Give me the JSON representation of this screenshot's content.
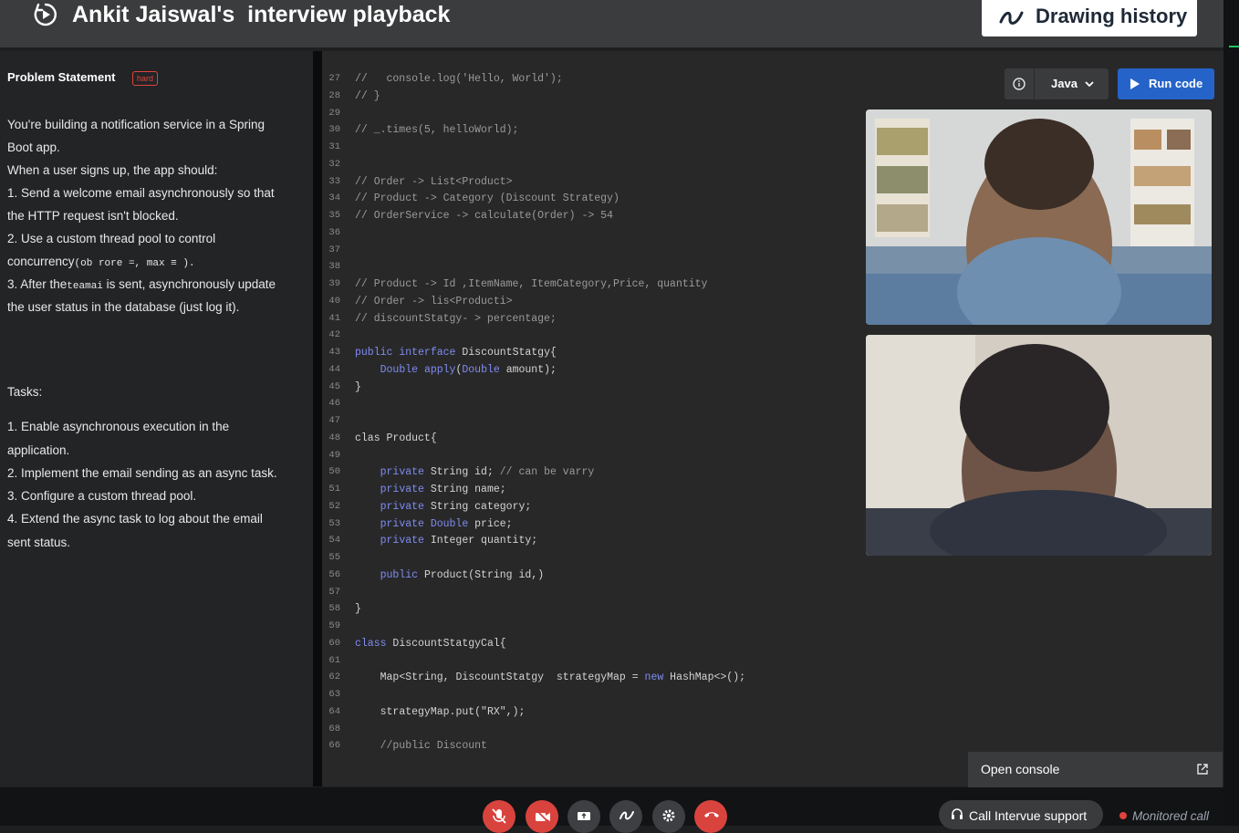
{
  "header": {
    "title": "Ankit Jaiswal's  interview playback",
    "drawing_history_label": "Drawing history"
  },
  "problem": {
    "heading": "Problem Statement",
    "difficulty": "hard",
    "paragraphs": [
      "You're building a notification service in a Spring",
      "Boot app.",
      " When a user signs up, the app should:",
      "1. Send a welcome email asynchronously so that",
      "the HTTP request isn't blocked.",
      "2. Use a custom thread pool to control",
      "3. After the",
      " is sent, asynchronously update",
      "the user status in the database (just log it)."
    ],
    "concurrency_prefix": "concurrency",
    "concurrency_smudge": "(ob rore =, max ≡ ).",
    "after_smudge": "teamai",
    "tasks_heading": "Tasks:",
    "tasks": [
      "1. Enable asynchronous execution in the",
      "application.",
      "2. Implement the email sending as an async task.",
      "3. Configure a custom thread pool.",
      "4. Extend the async task to log about the email",
      "sent status."
    ]
  },
  "toolbar": {
    "language": "Java",
    "run_label": "Run code"
  },
  "code": [
    {
      "n": "27",
      "t": "//   console.log('Hello, World');",
      "k": "com"
    },
    {
      "n": "28",
      "t": "// }",
      "k": "com"
    },
    {
      "n": "29",
      "t": "",
      "k": ""
    },
    {
      "n": "30",
      "t": "// _.times(5, helloWorld);",
      "k": "com"
    },
    {
      "n": "31",
      "t": "",
      "k": ""
    },
    {
      "n": "32",
      "t": "",
      "k": ""
    },
    {
      "n": "33",
      "t": "// Order -> List<Product>",
      "k": "com"
    },
    {
      "n": "34",
      "t": "// Product -> Category (Discount Strategy)",
      "k": "com"
    },
    {
      "n": "35",
      "t": "// OrderService -> calculate(Order) -> 54",
      "k": "com"
    },
    {
      "n": "36",
      "t": "",
      "k": ""
    },
    {
      "n": "37",
      "t": "",
      "k": ""
    },
    {
      "n": "38",
      "t": "",
      "k": ""
    },
    {
      "n": "39",
      "t": "// Product -> Id ,ItemName, ItemCategory,Price, quantity",
      "k": "com"
    },
    {
      "n": "40",
      "t": "// Order -> lis<Producti>",
      "k": "com"
    },
    {
      "n": "41",
      "t": "// discountStatgy- > percentage;",
      "k": "com"
    },
    {
      "n": "42",
      "t": "",
      "k": ""
    },
    {
      "n": "43",
      "t": "public interface DiscountStatgy{",
      "k": "code"
    },
    {
      "n": "44",
      "t": "    Double apply(Double amount);",
      "k": "code"
    },
    {
      "n": "45",
      "t": "}",
      "k": "code"
    },
    {
      "n": "46",
      "t": "",
      "k": ""
    },
    {
      "n": "47",
      "t": "",
      "k": ""
    },
    {
      "n": "48",
      "t": "clas Product{",
      "k": "code"
    },
    {
      "n": "49",
      "t": "",
      "k": ""
    },
    {
      "n": "50",
      "t": "    private String id; // can be varry",
      "k": "code"
    },
    {
      "n": "51",
      "t": "    private String name;",
      "k": "code"
    },
    {
      "n": "52",
      "t": "    private String category;",
      "k": "code"
    },
    {
      "n": "53",
      "t": "    private Double price;",
      "k": "code"
    },
    {
      "n": "54",
      "t": "    private Integer quantity;",
      "k": "code"
    },
    {
      "n": "55",
      "t": "",
      "k": ""
    },
    {
      "n": "56",
      "t": "    public Product(String id,)",
      "k": "code"
    },
    {
      "n": "57",
      "t": "",
      "k": ""
    },
    {
      "n": "58",
      "t": "}",
      "k": "code"
    },
    {
      "n": "59",
      "t": "",
      "k": ""
    },
    {
      "n": "60",
      "t": "class DiscountStatgyCal{",
      "k": "code"
    },
    {
      "n": "61",
      "t": "",
      "k": ""
    },
    {
      "n": "62",
      "t": "    Map<String, DiscountStatgy  strategyMap = new HashMap<>();",
      "k": "code"
    },
    {
      "n": "63",
      "t": "",
      "k": ""
    },
    {
      "n": "64",
      "t": "    strategyMap.put(\"RX\",);",
      "k": "code"
    },
    {
      "n": "68",
      "t": "",
      "k": ""
    },
    {
      "n": "66",
      "t": "    //public Discount",
      "k": "com"
    }
  ],
  "console": {
    "open_label": "Open console"
  },
  "footer": {
    "support_label": "Call Intervue support",
    "monitored_label": "Monitored call"
  },
  "colors": {
    "accent": "#2563c9",
    "danger": "#d9433e",
    "keyword": "#7f8cf0"
  }
}
